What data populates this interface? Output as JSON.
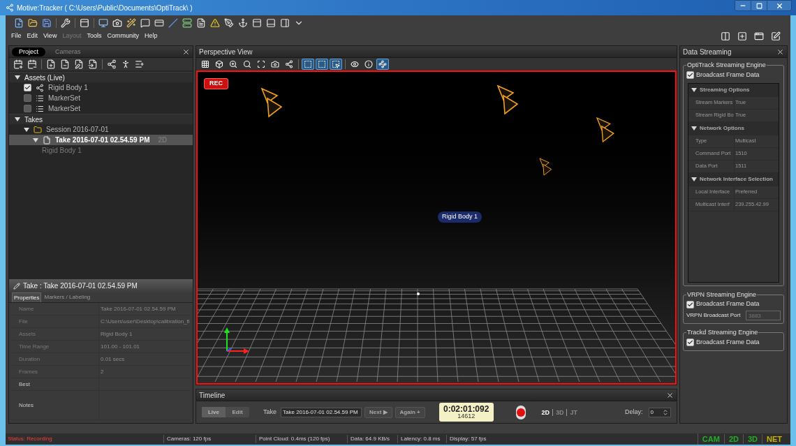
{
  "window": {
    "title": "Motive:Tracker ( C:\\Users\\Public\\Documents\\OptiTrack\\ )"
  },
  "menu": [
    {
      "label": "File",
      "disabled": false
    },
    {
      "label": "Edit",
      "disabled": false
    },
    {
      "label": "View",
      "disabled": false
    },
    {
      "label": "Layout",
      "disabled": true
    },
    {
      "label": "Tools",
      "disabled": false
    },
    {
      "label": "Community",
      "disabled": false
    },
    {
      "label": "Help",
      "disabled": false
    }
  ],
  "project_panel": {
    "tabs": [
      {
        "label": "Project",
        "selected": true
      },
      {
        "label": "Cameras",
        "selected": false
      }
    ],
    "tree": [
      {
        "label": "Assets (Live)",
        "kind": "group",
        "expanded": true,
        "children": [
          {
            "label": "Rigid Body 1",
            "kind": "rigid_body",
            "checked": true
          },
          {
            "label": "MarkerSet",
            "kind": "markerset",
            "checked": false
          },
          {
            "label": "MarkerSet",
            "kind": "markerset",
            "checked": false
          }
        ]
      },
      {
        "label": "Takes",
        "kind": "group",
        "expanded": true,
        "children": [
          {
            "label": "Session 2016-07-01",
            "kind": "session",
            "expanded": true,
            "children": [
              {
                "label": "Take 2016-07-01 02.54.59 PM",
                "kind": "take",
                "selected": true,
                "expanded": true,
                "badge": "2D",
                "children": [
                  {
                    "label": "Rigid Body 1",
                    "kind": "take_asset"
                  }
                ]
              }
            ]
          }
        ]
      }
    ]
  },
  "properties_panel": {
    "title": "Take : Take 2016-07-01 02.54.59 PM",
    "tabs": [
      {
        "label": "Properties",
        "selected": true
      },
      {
        "label": "Markers / Labeling",
        "selected": false
      }
    ],
    "rows": [
      {
        "name": "Name",
        "value": "Take 2016-07-01 02.54.59 PM",
        "editable": false,
        "kind": "text"
      },
      {
        "name": "File",
        "value": "C:\\Users\\user\\Desktop\\calibration_fi",
        "editable": false,
        "kind": "text"
      },
      {
        "name": "Assets",
        "value": "Rigid Body 1",
        "editable": false,
        "kind": "text"
      },
      {
        "name": "Time Range",
        "value": "101.00 - 101.01",
        "editable": false,
        "kind": "text"
      },
      {
        "name": "Duration",
        "value": "0.01 secs",
        "editable": false,
        "kind": "text"
      },
      {
        "name": "Frames",
        "value": "2",
        "editable": false,
        "kind": "text"
      },
      {
        "name": "Best",
        "editable": true,
        "kind": "text"
      },
      {
        "name": "Notes",
        "editable": true,
        "kind": "multiline"
      }
    ]
  },
  "perspective_view": {
    "title": "Perspective View",
    "toolbar": [
      {
        "kind": "grid",
        "selected": false
      },
      {
        "kind": "cube",
        "selected": false
      },
      {
        "kind": "zoom",
        "selected": false
      },
      {
        "kind": "zoom_region",
        "selected": false
      },
      {
        "kind": "zoom_fit",
        "selected": false
      },
      {
        "kind": "camera",
        "selected": false
      },
      {
        "kind": "rigid_body",
        "selected": false
      },
      {
        "kind": "select_marker",
        "selected": true
      },
      {
        "kind": "select_camera",
        "selected": true
      },
      {
        "kind": "select_add",
        "selected": true
      },
      {
        "kind": "eye",
        "selected": false
      },
      {
        "kind": "info",
        "selected": false
      },
      {
        "kind": "skeleton",
        "selected": true
      }
    ],
    "rec_badge": "REC",
    "rigid_body_label": "Rigid Body 1"
  },
  "data_streaming": {
    "title": "Data Streaming",
    "optitrack": {
      "title": "OptiTrack Streaming Engine",
      "broadcast": {
        "label": "Broadcast Frame Data",
        "checked": true
      },
      "sections": [
        {
          "title": "Streaming Options",
          "expanded": true,
          "rows": [
            {
              "name": "Stream Markers",
              "value": "True"
            },
            {
              "name": "Stream Rigid Bo",
              "value": "True"
            }
          ]
        },
        {
          "title": "Network Options",
          "expanded": true,
          "rows": [
            {
              "name": "Type",
              "value": "Multicast"
            },
            {
              "name": "Command Port",
              "value": "1510"
            },
            {
              "name": "Data Port",
              "value": "1511"
            }
          ]
        },
        {
          "title": "Network Interface Selection",
          "expanded": true,
          "rows": [
            {
              "name": "Local Interface",
              "value": "Preferred"
            },
            {
              "name": "Multicast Interf",
              "value": "239.255.42.99"
            }
          ]
        }
      ]
    },
    "vrpn": {
      "title": "VRPN Streaming Engine",
      "broadcast": {
        "label": "Broadcast Frame Data",
        "checked": true
      },
      "port_label": "VRPN Broadcast Port",
      "port_value": "3883",
      "port_disabled": true
    },
    "trackd": {
      "title": "Trackd Streaming Engine",
      "broadcast": {
        "label": "Broadcast Frame Data",
        "checked": true
      }
    }
  },
  "timeline": {
    "title": "Timeline",
    "modes": [
      {
        "label": "Live",
        "selected": true
      },
      {
        "label": "Edit",
        "selected": false
      }
    ],
    "take_label": "Take",
    "take_value": "Take 2016-07-01 02.54.59 PM",
    "buttons": [
      {
        "label": "Next ▶",
        "disabled": true
      },
      {
        "label": "Again +",
        "disabled": true
      }
    ],
    "timecode": "0:02:01:092",
    "frame": "14612",
    "views": [
      {
        "label": "2D",
        "selected": true
      },
      {
        "label": "3D",
        "selected": false
      },
      {
        "label": "JT",
        "selected": false
      }
    ],
    "delay_label": "Delay:",
    "delay_value": "0"
  },
  "status_bar": {
    "status": "Status: Recording",
    "items": [
      "Cameras: 120 fps",
      "Point Cloud: 0.4ms (120 fps)",
      "Data: 64.9 KB/s",
      "Latency: 0.8 ms",
      "Display: 57 fps"
    ],
    "indicators": [
      {
        "label": "CAM",
        "color": "#22b022"
      },
      {
        "label": "2D",
        "color": "#22b022"
      },
      {
        "label": "3D",
        "color": "#22b022"
      },
      {
        "label": "NET",
        "color": "#c8b400"
      }
    ]
  }
}
